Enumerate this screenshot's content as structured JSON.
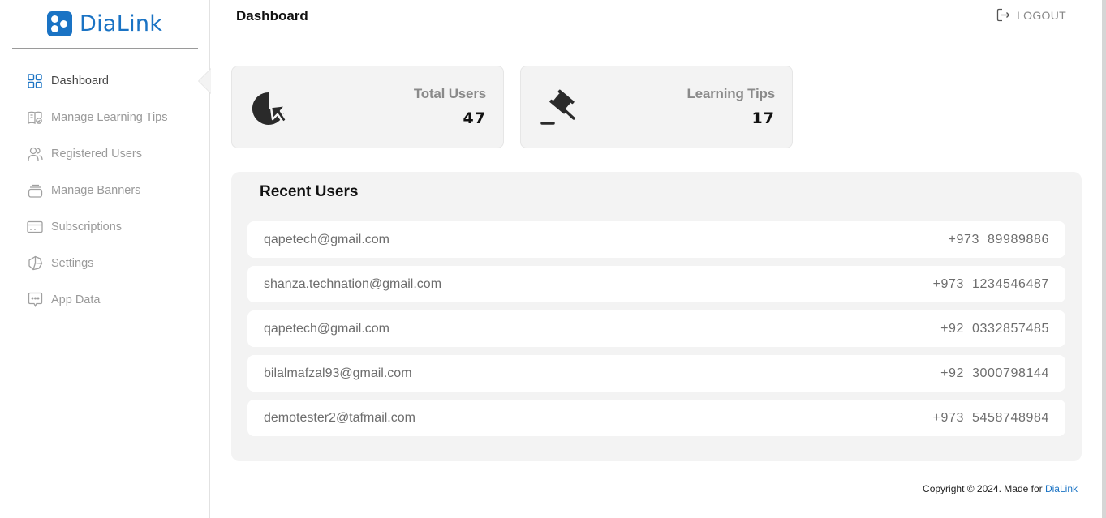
{
  "app": {
    "name": "DiaLink",
    "accent": "#1a73c4"
  },
  "sidebar": {
    "items": [
      {
        "label": "Dashboard",
        "icon": "grid-icon",
        "active": true
      },
      {
        "label": "Manage Learning Tips",
        "icon": "book-icon",
        "active": false
      },
      {
        "label": "Registered Users",
        "icon": "users-icon",
        "active": false
      },
      {
        "label": "Manage Banners",
        "icon": "banner-icon",
        "active": false
      },
      {
        "label": "Subscriptions",
        "icon": "card-icon",
        "active": false
      },
      {
        "label": "Settings",
        "icon": "settings-icon",
        "active": false
      },
      {
        "label": "App Data",
        "icon": "chat-icon",
        "active": false
      }
    ]
  },
  "header": {
    "title": "Dashboard",
    "logout_label": "LOGOUT"
  },
  "stats": [
    {
      "title": "Total Users",
      "value": "47",
      "icon": "pie-pointer-icon"
    },
    {
      "title": "Learning Tips",
      "value": "17",
      "icon": "gavel-icon"
    }
  ],
  "recent_users": {
    "title": "Recent Users",
    "rows": [
      {
        "email": "qapetech@gmail.com",
        "country_code": "+973",
        "phone": "89989886"
      },
      {
        "email": "shanza.technation@gmail.com",
        "country_code": "+973",
        "phone": "1234546487"
      },
      {
        "email": "qapetech@gmail.com",
        "country_code": "+92",
        "phone": "0332857485"
      },
      {
        "email": "bilalmafzal93@gmail.com",
        "country_code": "+92",
        "phone": "3000798144"
      },
      {
        "email": "demotester2@tafmail.com",
        "country_code": "+973",
        "phone": "5458748984"
      }
    ]
  },
  "footer": {
    "text": "Copyright © 2024. Made for ",
    "brand": "DiaLink"
  }
}
